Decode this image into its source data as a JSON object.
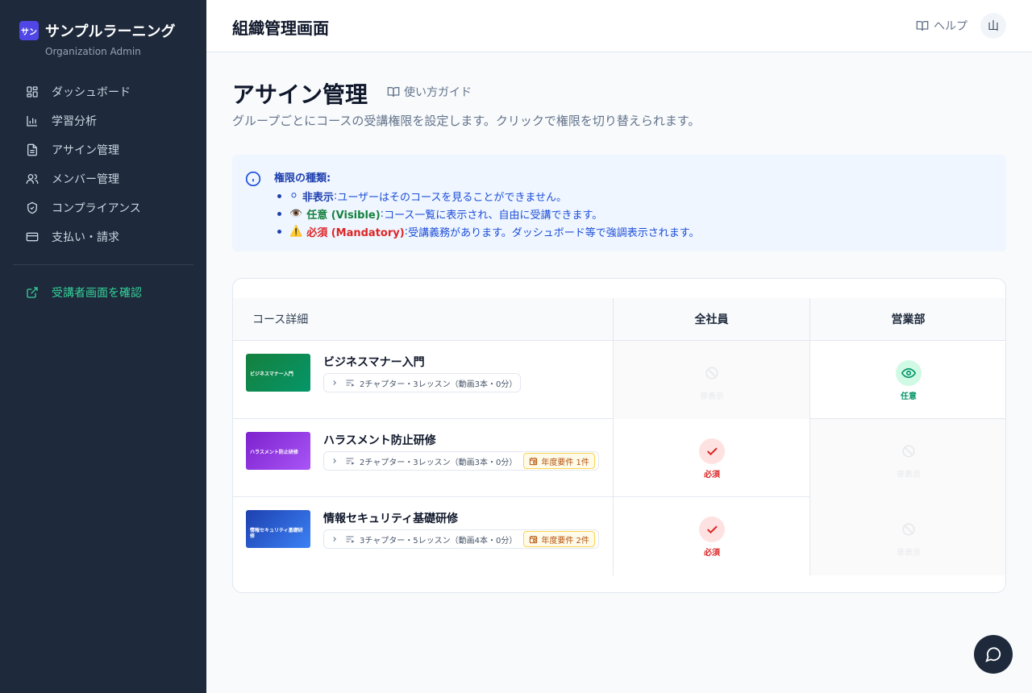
{
  "sidebar": {
    "logo_text": "サン",
    "brand_name": "サンプルラーニング",
    "brand_sub": "Organization Admin",
    "items": [
      {
        "label": "ダッシュボード",
        "icon": "grid-icon"
      },
      {
        "label": "学習分析",
        "icon": "bar-chart-icon"
      },
      {
        "label": "アサイン管理",
        "icon": "file-text-icon"
      },
      {
        "label": "メンバー管理",
        "icon": "users-icon"
      },
      {
        "label": "コンプライアンス",
        "icon": "shield-check-icon"
      },
      {
        "label": "支払い・請求",
        "icon": "credit-card-icon"
      }
    ],
    "learner_link": "受講者画面を確認",
    "learner_color": "#34d399"
  },
  "header": {
    "title": "組織管理画面",
    "help": "ヘルプ",
    "avatar": "山"
  },
  "main": {
    "title": "アサイン管理",
    "guide": "使い方ガイド",
    "description": "グループごとにコースの受講権限を設定します。クリックで権限を切り替えられます。"
  },
  "info": {
    "title": "権限の種類:",
    "items": [
      {
        "emoji": "⚪",
        "key": "非表示",
        "sep": " : ",
        "text": "ユーザーはそのコースを見ることができません。"
      },
      {
        "emoji": "👁️",
        "key": "任意 (Visible)",
        "sep": " : ",
        "text": "コース一覧に表示され、自由に受講できます。"
      },
      {
        "emoji": "⚠️",
        "key": "必須 (Mandatory)",
        "sep": " : ",
        "text": "受講義務があります。ダッシュボード等で強調表示されます。"
      }
    ]
  },
  "table": {
    "headers": {
      "course": "コース詳細",
      "group1": "全社員",
      "group2": "営業部"
    },
    "rows": [
      {
        "name": "ビジネスマナー入門",
        "thumb_text": "ビジネスマナー入門",
        "thumb_color": "#15803d",
        "lessons": "2チャプター・3レッスン（動画3本・0分）",
        "badge": "",
        "group1": {
          "state": "hidden",
          "label": "非表示"
        },
        "group2": {
          "state": "visible",
          "label": "任意"
        }
      },
      {
        "name": "ハラスメント防止研修",
        "thumb_text": "ハラスメント防止研修",
        "thumb_color": "#7e22ce",
        "lessons": "2チャプター・3レッスン（動画3本・0分）",
        "badge": "年度要件 1件",
        "group1": {
          "state": "mandatory",
          "label": "必須"
        },
        "group2": {
          "state": "hidden",
          "label": "非表示"
        }
      },
      {
        "name": "情報セキュリティ基礎研修",
        "thumb_text": "情報セキュリティ基礎研修",
        "thumb_color": "#1e40af",
        "lessons": "3チャプター・5レッスン（動画4本・0分）",
        "badge": "年度要件 2件",
        "group1": {
          "state": "mandatory",
          "label": "必須"
        },
        "group2": {
          "state": "hidden",
          "label": "非表示"
        }
      }
    ]
  },
  "colors": {
    "sidebar_bg": "#1e293b",
    "visible": "#059669",
    "mandatory": "#dc2626",
    "info_bg": "#eff6ff"
  }
}
